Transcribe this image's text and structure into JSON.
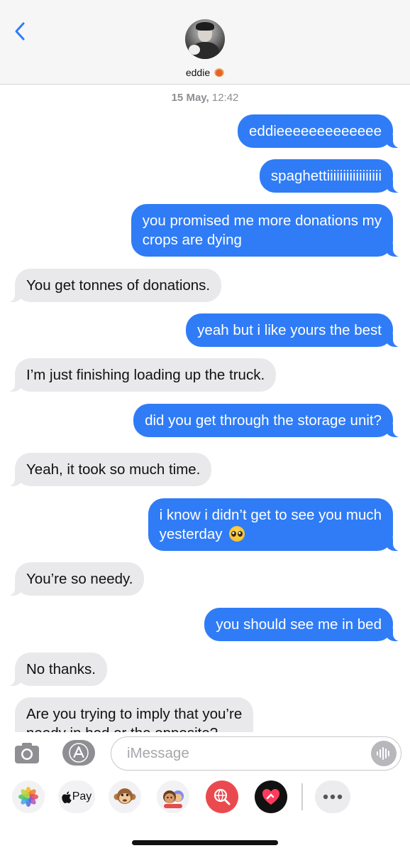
{
  "header": {
    "contact_name": "eddie",
    "back_icon": "chevron-left-icon",
    "name_icon": "spaghetti-icon"
  },
  "thread": {
    "timestamp_date": "15 May,",
    "timestamp_time": "12:42",
    "messages": [
      {
        "direction": "out",
        "text": "eddieeeeeeeeeeeee"
      },
      {
        "direction": "out",
        "text": "spaghettiiiiiiiiiiiiiiiii"
      },
      {
        "direction": "out",
        "line1": "you promised me more donations my",
        "line2": "crops are dying"
      },
      {
        "direction": "in",
        "text": "You get tonnes of donations."
      },
      {
        "direction": "out",
        "text": "yeah but i like yours the best"
      },
      {
        "direction": "in",
        "text": "I’m just finishing loading up the truck."
      },
      {
        "direction": "out",
        "text": "did you get through the storage unit?"
      },
      {
        "direction": "in",
        "text": "Yeah, it took so much time."
      },
      {
        "direction": "out",
        "line1": "i know i didn’t get to see you much",
        "line2": "yesterday",
        "emoji": "pleading-face-emoji"
      },
      {
        "direction": "in",
        "text": "You’re so needy."
      },
      {
        "direction": "out",
        "text": "you should see me in bed"
      },
      {
        "direction": "in",
        "text": "No thanks."
      },
      {
        "direction": "in",
        "line1": "Are you trying to imply that you’re",
        "line2": "needy in bed or the opposite?"
      }
    ]
  },
  "composer": {
    "placeholder": "iMessage",
    "camera_icon": "camera-icon",
    "appstore_icon": "app-store-icon",
    "audio_icon": "audio-waveform-icon"
  },
  "apps": {
    "apple_pay_label": "Pay",
    "items": [
      "photos-app",
      "apple-pay-app",
      "animoji-app",
      "memoji-app",
      "search-images-app",
      "digital-touch-app",
      "more-apps"
    ]
  },
  "colors": {
    "outgoing_bubble": "#2f7cf6",
    "incoming_bubble": "#e9e9eb",
    "header_bg": "#f6f6f7",
    "accent": "#2f7cf6"
  }
}
